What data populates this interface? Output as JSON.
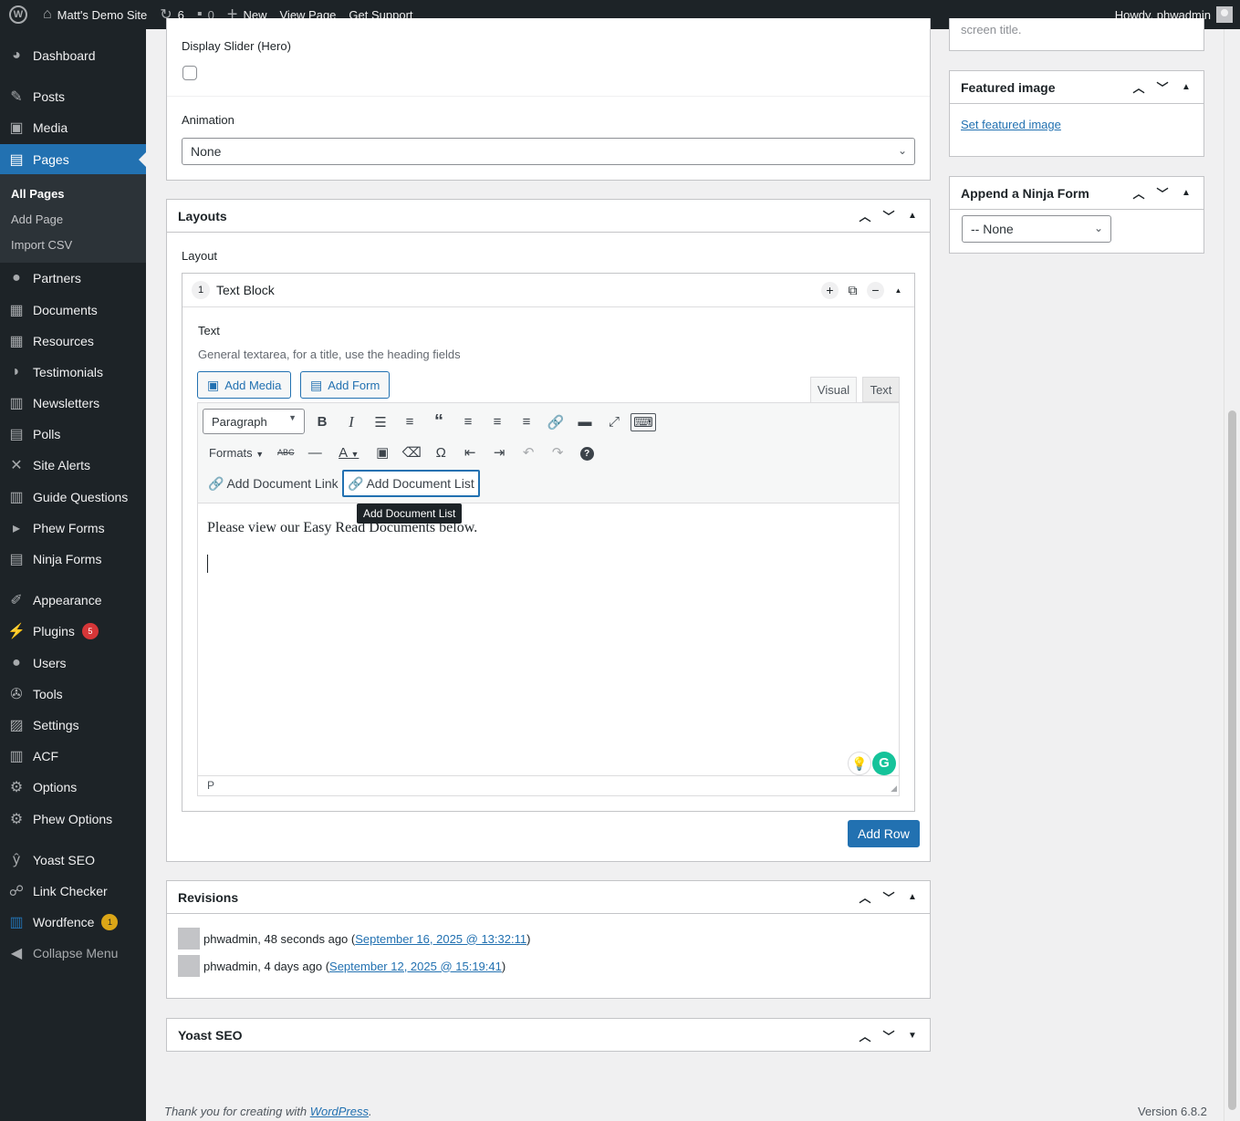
{
  "admin_bar": {
    "site_name": "Matt's Demo Site",
    "updates_count": "6",
    "comments_count": "0",
    "new_label": "New",
    "view_page": "View Page",
    "get_support": "Get Support",
    "howdy": "Howdy, phwadmin"
  },
  "sidebar": {
    "dashboard": "Dashboard",
    "posts": "Posts",
    "media": "Media",
    "pages": "Pages",
    "pages_sub": {
      "all": "All Pages",
      "add": "Add Page",
      "import": "Import CSV"
    },
    "partners": "Partners",
    "documents": "Documents",
    "resources": "Resources",
    "testimonials": "Testimonials",
    "newsletters": "Newsletters",
    "polls": "Polls",
    "site_alerts": "Site Alerts",
    "guide_questions": "Guide Questions",
    "phew_forms": "Phew Forms",
    "ninja_forms": "Ninja Forms",
    "appearance": "Appearance",
    "plugins": "Plugins",
    "plugins_badge": "5",
    "users": "Users",
    "tools": "Tools",
    "settings": "Settings",
    "acf": "ACF",
    "options": "Options",
    "phew_options": "Phew Options",
    "yoast": "Yoast SEO",
    "link_checker": "Link Checker",
    "wordfence": "Wordfence",
    "wordfence_badge": "1",
    "collapse": "Collapse Menu"
  },
  "hero": {
    "display_slider_label": "Display Slider (Hero)",
    "display_slider_checked": false,
    "animation_label": "Animation",
    "animation_value": "None"
  },
  "layouts": {
    "title": "Layouts",
    "layout_label": "Layout",
    "row_number": "1",
    "row_title": "Text Block",
    "text_label": "Text",
    "text_instructions": "General textarea, for a title, use the heading fields",
    "add_media": "Add Media",
    "add_form": "Add Form",
    "tab_visual": "Visual",
    "tab_text": "Text",
    "paragraph_select": "Paragraph",
    "formats": "Formats",
    "add_document_link": "Add Document Link",
    "add_document_list": "Add Document List",
    "tooltip": "Add Document List",
    "content": "Please view our Easy Read Documents below.",
    "path": "P",
    "add_row": "Add Row"
  },
  "revisions": {
    "title": "Revisions",
    "items": [
      {
        "author": "phwadmin, 48 seconds ago (",
        "link": "September 16, 2025 @ 13:32:11",
        "close": ")"
      },
      {
        "author": "phwadmin, 4 days ago (",
        "link": "September 12, 2025 @ 15:19:41",
        "close": ")"
      }
    ]
  },
  "yoast_box": {
    "title": "Yoast SEO"
  },
  "right_col": {
    "partial_text": "screen title.",
    "featured_title": "Featured image",
    "set_featured": "Set featured image",
    "ninja_title": "Append a Ninja Form",
    "ninja_value": "-- None"
  },
  "footer": {
    "thanks_prefix": "Thank you for creating with ",
    "wp_link": "WordPress",
    "thanks_suffix": ".",
    "version": "Version 6.8.2"
  }
}
